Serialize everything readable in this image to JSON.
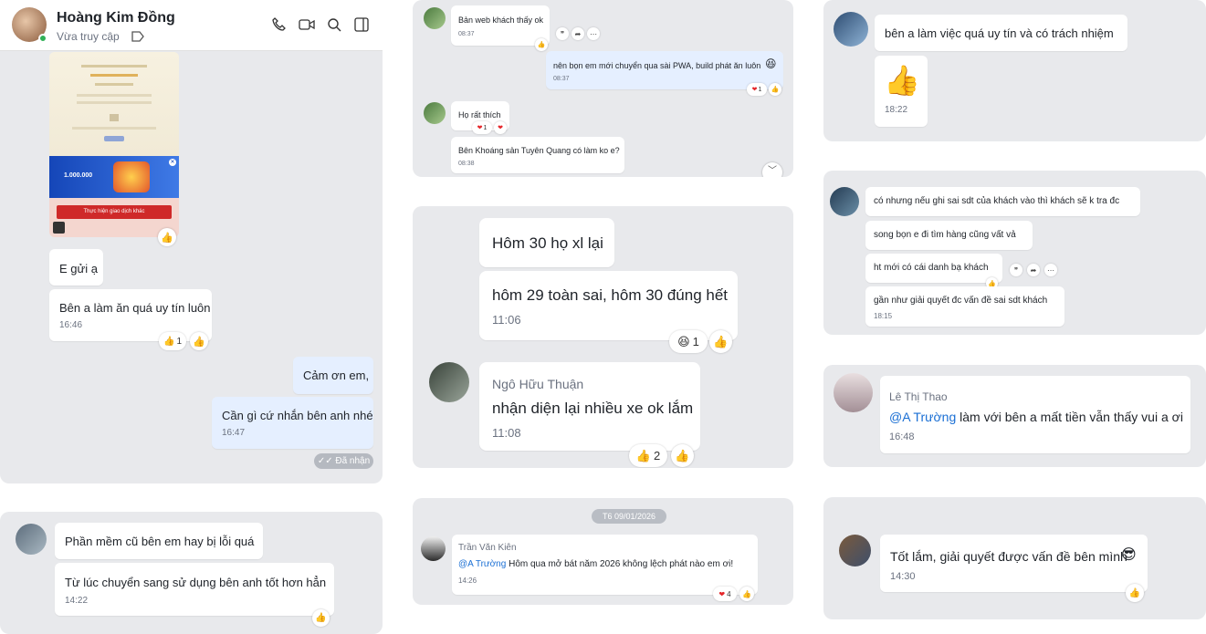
{
  "header": {
    "name": "Hoàng Kim Đồng",
    "status": "Vừa truy cập"
  },
  "p1": {
    "thumb_amount": "1.000.000",
    "thumb_button": "Thực hiện giao dịch khác",
    "msg1": "E gửi ạ",
    "msg2": "Bên a làm ăn quá uy tín luôn",
    "msg2_time": "16:46",
    "msg2_react_count": "1",
    "msg3": "Cảm ơn em,",
    "msg4": "Cần gì cứ nhắn bên anh nhé",
    "msg4_time": "16:47",
    "status_badge": "Đã nhận"
  },
  "p2": {
    "msg1": "Phần mềm cũ bên em hay bị lỗi quá",
    "msg2": "Từ lúc chuyển sang sử dụng bên anh tốt hơn hẳn",
    "msg2_time": "14:22"
  },
  "p3": {
    "msg1": "Bản web khách thấy ok",
    "msg1_time": "08:37",
    "msg2": "nên bọn em mới chuyển qua sài PWA, build phát ăn luôn",
    "msg2_time": "08:37",
    "msg2_react_count": "1",
    "msg3": "Họ rất thích",
    "msg3_react_count": "1",
    "msg4": "Bên Khoáng sản Tuyên Quang có làm ko e?",
    "msg4_time": "08:38"
  },
  "p4": {
    "msg1": "Hôm 30 họ xl lại",
    "msg2": "hôm 29 toàn sai, hôm 30 đúng hết",
    "msg2_time": "11:06",
    "msg2_react_count": "1",
    "sender": "Ngô Hữu Thuận",
    "msg3": "nhận diện lại nhiều xe ok lắm",
    "msg3_time": "11:08",
    "msg3_react_count": "2"
  },
  "p5": {
    "date": "T6 09/01/2026",
    "sender": "Trần Văn Kiên",
    "mention": "@A Trường",
    "msg": " Hôm qua mở bát năm 2026 không lệch phát nào em ơi!",
    "time": "14:26",
    "react_count": "4"
  },
  "p6": {
    "msg1": "bên a làm việc quá uy tín và có trách nhiệm",
    "sticker_time": "18:22"
  },
  "p7": {
    "msg1": "có nhưng nếu ghi sai sdt của khách vào thì khách sẽ k tra đc",
    "msg2": "song bọn e đi tìm hàng cũng vất vả",
    "msg3": "ht mới có cái danh bạ khách",
    "msg4": "gần như giải quyết đc vấn đề sai sdt khách",
    "msg4_time": "18:15"
  },
  "p8": {
    "sender": "Lê Thị Thao",
    "mention": "@A Trường",
    "msg": " làm với bên a mất tiền vẫn thấy vui a ơi",
    "time": "16:48"
  },
  "p9": {
    "msg": "Tốt lắm, giải quyết được vấn đề bên mình",
    "time": "14:30"
  }
}
